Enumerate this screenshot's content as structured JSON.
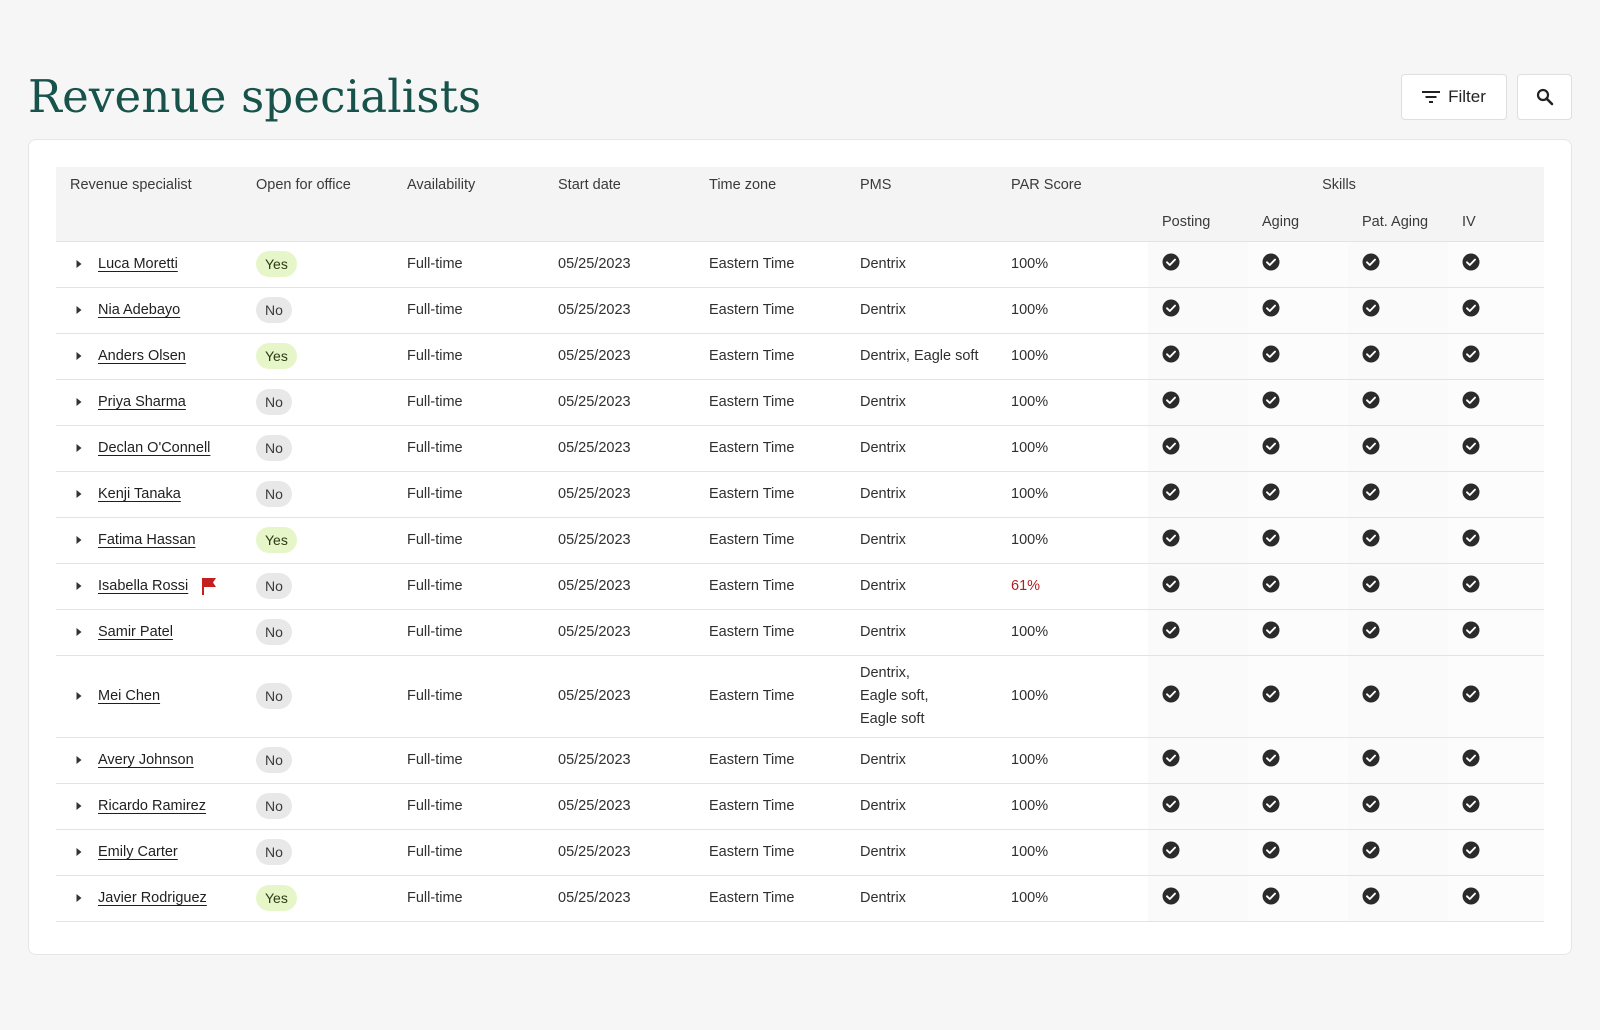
{
  "page": {
    "title": "Revenue specialists",
    "filter_label": "Filter"
  },
  "colors": {
    "title": "#17524b",
    "yes_badge_bg": "#e6f6c9",
    "no_badge_bg": "#e8e8e8",
    "par_warning": "#b21d1d",
    "flag": "#c41f1f"
  },
  "icons": {
    "filter": "filter-icon",
    "search": "search-icon",
    "expand": "caret-right-icon",
    "flag": "flag-icon",
    "skill": "check-circle-icon"
  },
  "table": {
    "columns": {
      "specialist": "Revenue specialist",
      "open": "Open for office",
      "availability": "Availability",
      "start": "Start date",
      "tz": "Time zone",
      "pms": "PMS",
      "par": "PAR Score",
      "skills": "Skills",
      "posting": "Posting",
      "aging": "Aging",
      "pat_aging": "Pat. Aging",
      "iv": "IV"
    },
    "rows": [
      {
        "name": "Luca Moretti",
        "open": "Yes",
        "availability": "Full-time",
        "start": "05/25/2023",
        "tz": "Eastern Time",
        "pms": [
          "Dentrix"
        ],
        "par": "100%",
        "flag": false,
        "low": false
      },
      {
        "name": "Nia Adebayo",
        "open": "No",
        "availability": "Full-time",
        "start": "05/25/2023",
        "tz": "Eastern Time",
        "pms": [
          "Dentrix"
        ],
        "par": "100%",
        "flag": false,
        "low": false
      },
      {
        "name": "Anders Olsen",
        "open": "Yes",
        "availability": "Full-time",
        "start": "05/25/2023",
        "tz": "Eastern Time",
        "pms": [
          "Dentrix,  Eagle soft"
        ],
        "par": "100%",
        "flag": false,
        "low": false
      },
      {
        "name": "Priya Sharma",
        "open": "No",
        "availability": "Full-time",
        "start": "05/25/2023",
        "tz": "Eastern Time",
        "pms": [
          "Dentrix"
        ],
        "par": "100%",
        "flag": false,
        "low": false
      },
      {
        "name": "Declan O'Connell",
        "open": "No",
        "availability": "Full-time",
        "start": "05/25/2023",
        "tz": "Eastern Time",
        "pms": [
          "Dentrix"
        ],
        "par": "100%",
        "flag": false,
        "low": false
      },
      {
        "name": "Kenji Tanaka",
        "open": "No",
        "availability": "Full-time",
        "start": "05/25/2023",
        "tz": "Eastern Time",
        "pms": [
          "Dentrix"
        ],
        "par": "100%",
        "flag": false,
        "low": false
      },
      {
        "name": "Fatima Hassan",
        "open": "Yes",
        "availability": "Full-time",
        "start": "05/25/2023",
        "tz": "Eastern Time",
        "pms": [
          "Dentrix"
        ],
        "par": "100%",
        "flag": false,
        "low": false
      },
      {
        "name": "Isabella Rossi",
        "open": "No",
        "availability": "Full-time",
        "start": "05/25/2023",
        "tz": "Eastern Time",
        "pms": [
          "Dentrix"
        ],
        "par": "61%",
        "flag": true,
        "low": true
      },
      {
        "name": "Samir Patel",
        "open": "No",
        "availability": "Full-time",
        "start": "05/25/2023",
        "tz": "Eastern Time",
        "pms": [
          "Dentrix"
        ],
        "par": "100%",
        "flag": false,
        "low": false
      },
      {
        "name": "Mei Chen",
        "open": "No",
        "availability": "Full-time",
        "start": "05/25/2023",
        "tz": "Eastern Time",
        "pms": [
          "Dentrix,",
          "Eagle soft,",
          "Eagle soft"
        ],
        "par": "100%",
        "flag": false,
        "low": false
      },
      {
        "name": "Avery Johnson",
        "open": "No",
        "availability": "Full-time",
        "start": "05/25/2023",
        "tz": "Eastern Time",
        "pms": [
          "Dentrix"
        ],
        "par": "100%",
        "flag": false,
        "low": false
      },
      {
        "name": "Ricardo Ramirez",
        "open": "No",
        "availability": "Full-time",
        "start": "05/25/2023",
        "tz": "Eastern Time",
        "pms": [
          "Dentrix"
        ],
        "par": "100%",
        "flag": false,
        "low": false
      },
      {
        "name": "Emily Carter",
        "open": "No",
        "availability": "Full-time",
        "start": "05/25/2023",
        "tz": "Eastern Time",
        "pms": [
          "Dentrix"
        ],
        "par": "100%",
        "flag": false,
        "low": false
      },
      {
        "name": "Javier Rodriguez",
        "open": "Yes",
        "availability": "Full-time",
        "start": "05/25/2023",
        "tz": "Eastern Time",
        "pms": [
          "Dentrix"
        ],
        "par": "100%",
        "flag": false,
        "low": false
      }
    ]
  }
}
